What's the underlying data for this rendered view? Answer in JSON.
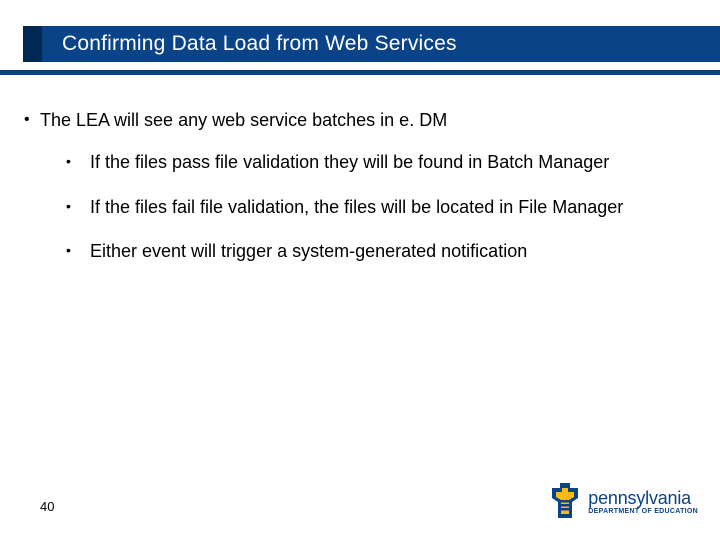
{
  "title": "Confirming Data Load from Web Services",
  "bullets": {
    "l1": "The LEA will see any web service batches in e. DM",
    "sub1": "If the files pass file validation they will be found in Batch Manager",
    "sub2": "If the files fail file validation, the files will be located in File Manager",
    "sub3": "Either event will trigger a system-generated notification"
  },
  "page_number": "40",
  "logo": {
    "state": "pennsylvania",
    "dept": "DEPARTMENT OF EDUCATION"
  }
}
